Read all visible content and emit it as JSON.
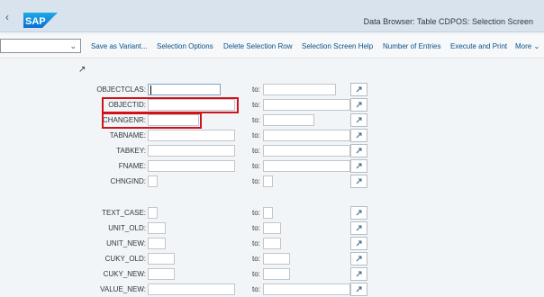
{
  "header": {
    "back_icon": "chevron-left-icon",
    "logo": "SAP",
    "title": "Data Browser: Table CDPOS: Selection Screen"
  },
  "toolbar": {
    "variant_value": "",
    "buttons": [
      "Save as Variant...",
      "Selection Options",
      "Delete Selection Row",
      "Selection Screen Help",
      "Number of Entries",
      "Execute and Print",
      "More"
    ]
  },
  "to_label": "to:",
  "fields": [
    {
      "label": "OBJECTCLAS:",
      "value": ""
    },
    {
      "label": "OBJECTID:",
      "value": ""
    },
    {
      "label": "CHANGENR:",
      "value": ""
    },
    {
      "label": "TABNAME:",
      "value": ""
    },
    {
      "label": "TABKEY:",
      "value": ""
    },
    {
      "label": "FNAME:",
      "value": ""
    },
    {
      "label": "CHNGIND:",
      "value": ""
    },
    {
      "label": "TEXT_CASE:",
      "value": ""
    },
    {
      "label": "UNIT_OLD:",
      "value": ""
    },
    {
      "label": "UNIT_NEW:",
      "value": ""
    },
    {
      "label": "CUKY_OLD:",
      "value": ""
    },
    {
      "label": "CUKY_NEW:",
      "value": ""
    },
    {
      "label": "VALUE_NEW:",
      "value": ""
    }
  ],
  "highlight_color": "#d0121b",
  "brand_color": "#0a6ed1"
}
